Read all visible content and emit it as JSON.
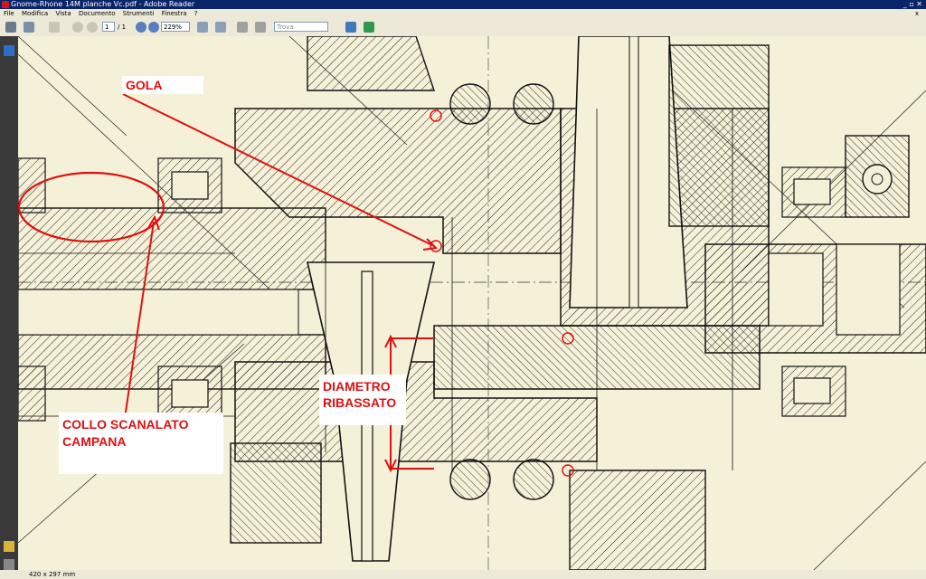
{
  "window": {
    "title": "Gnome-Rhone 14M planche Vc.pdf - Adobe Reader"
  },
  "menu": {
    "items": [
      "File",
      "Modifica",
      "Vista",
      "Documento",
      "Strumenti",
      "Finestra",
      "?"
    ],
    "close": "x"
  },
  "toolbar": {
    "page_current": "1",
    "page_total": "/ 1",
    "zoom": "229%",
    "search_placeholder": "Trova"
  },
  "annotations": {
    "gola": "GOLA",
    "diametro_line1": "DIAMETRO",
    "diametro_line2": "RIBASSATO",
    "collo_line1": "COLLO SCANALATO",
    "collo_line2": "CAMPANA"
  },
  "status": {
    "page_size": "420 x 297 mm"
  },
  "colors": {
    "annotation": "#e01010",
    "paper": "#f5f1d8",
    "ink": "#1a1a1a",
    "titlebar": "#0a246a"
  }
}
